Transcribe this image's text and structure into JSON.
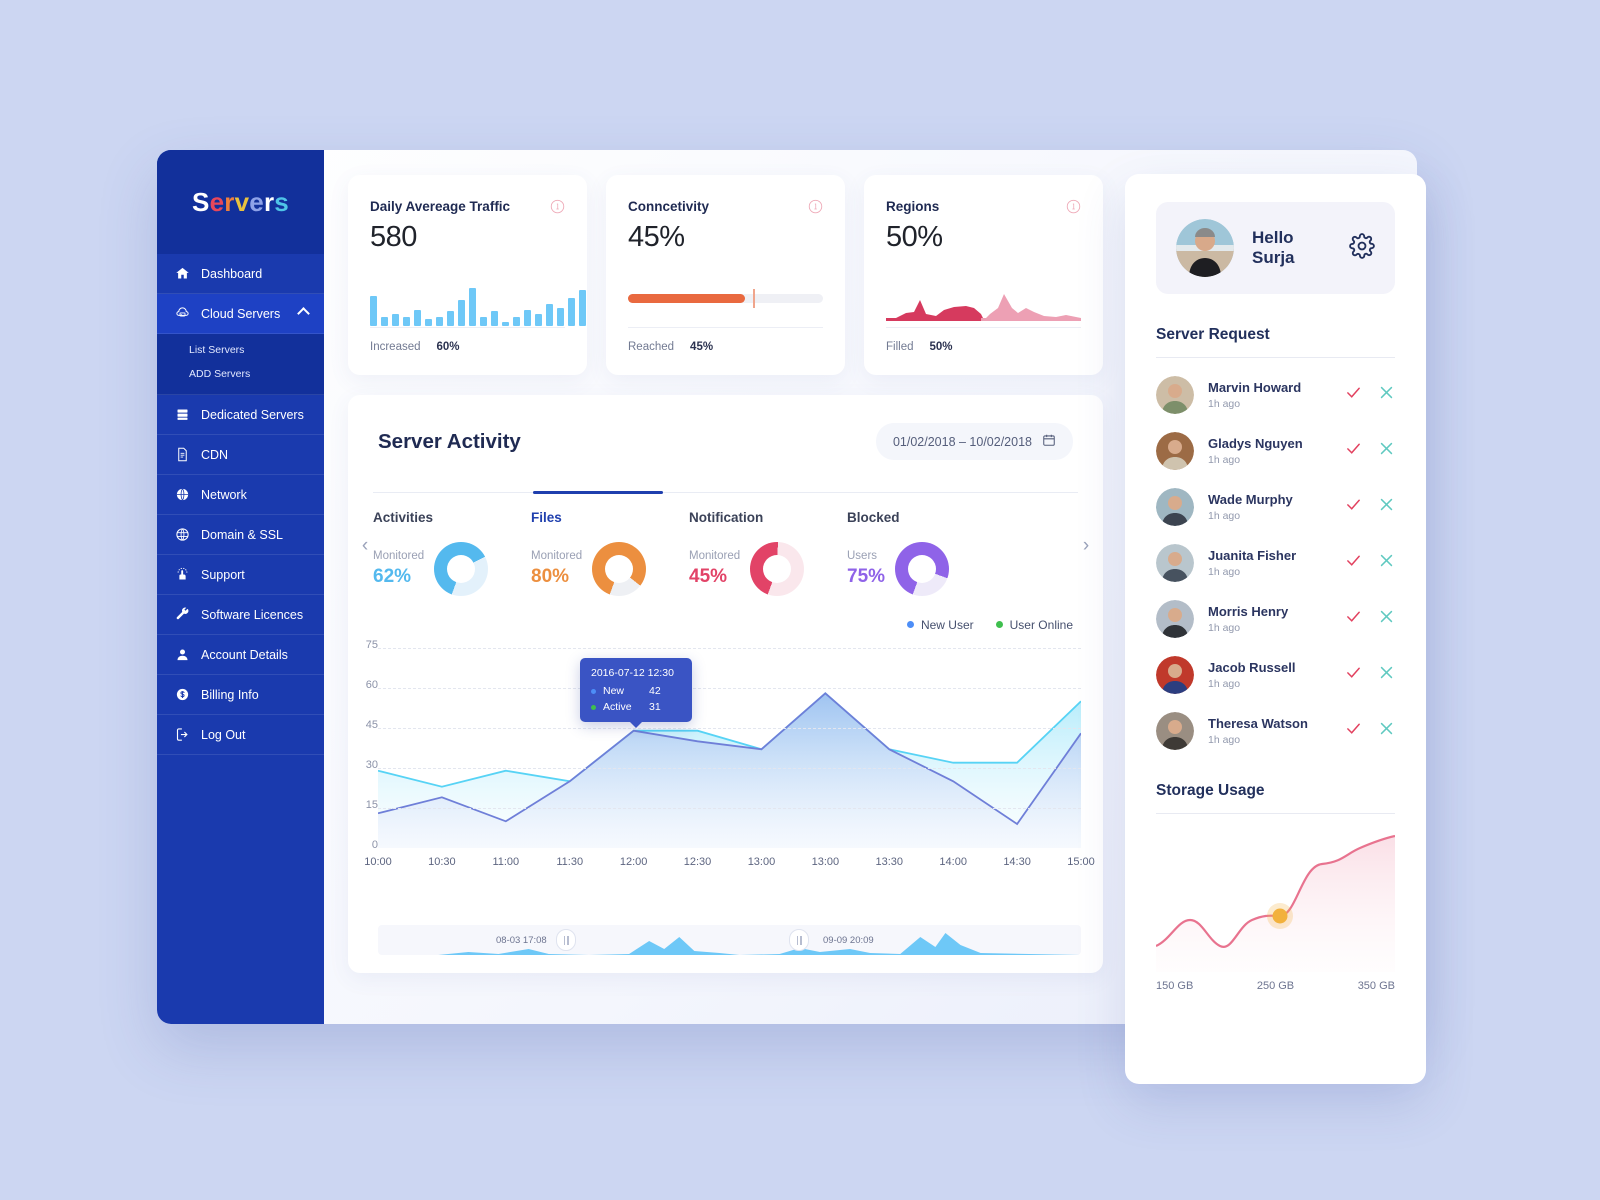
{
  "sidebar": {
    "logo": [
      {
        "ch": "S",
        "color": "#ffffff"
      },
      {
        "ch": "e",
        "color": "#e8475a"
      },
      {
        "ch": "r",
        "color": "#ef7f3c"
      },
      {
        "ch": "v",
        "color": "#e9c23f"
      },
      {
        "ch": "e",
        "color": "#8ea2e8"
      },
      {
        "ch": "r",
        "color": "#ffffff"
      },
      {
        "ch": "s",
        "color": "#4fc4e8"
      }
    ],
    "items": [
      {
        "label": "Dashboard",
        "icon": "home-icon",
        "active": false
      },
      {
        "label": "Cloud Servers",
        "icon": "cloud-server-icon",
        "active": true,
        "expanded": true
      },
      {
        "label": "Dedicated Servers",
        "icon": "server-rack-icon",
        "active": false
      },
      {
        "label": "CDN",
        "icon": "document-icon",
        "active": false
      },
      {
        "label": "Network",
        "icon": "globe-icon",
        "active": false
      },
      {
        "label": "Domain & SSL",
        "icon": "domain-icon",
        "active": false
      },
      {
        "label": "Support",
        "icon": "support-hand-icon",
        "active": false
      },
      {
        "label": "Software Licences",
        "icon": "wrench-icon",
        "active": false
      },
      {
        "label": "Account Details",
        "icon": "user-icon",
        "active": false
      },
      {
        "label": "Billing Info",
        "icon": "dollar-icon",
        "active": false
      },
      {
        "label": "Log Out",
        "icon": "logout-icon",
        "active": false
      }
    ],
    "subitems": [
      "List Servers",
      "ADD Servers"
    ]
  },
  "stats": [
    {
      "title": "Daily Avereage Traffic",
      "value": "580",
      "foot_label": "Increased",
      "foot_value": "60%",
      "viz": "bars",
      "color": "#6ec8f7"
    },
    {
      "title": "Conncetivity",
      "value": "45%",
      "foot_label": "Reached",
      "foot_value": "45%",
      "viz": "progress",
      "color": "#e9693f",
      "progress_pct": 60
    },
    {
      "title": "Regions",
      "value": "50%",
      "foot_label": "Filled",
      "foot_value": "50%",
      "viz": "area",
      "color": "#d0days"
    }
  ],
  "activity": {
    "title": "Server Activity",
    "date_range": "01/02/2018 – 10/02/2018",
    "calendar_icon": "calendar-icon",
    "prev_icon": "chevron-left-icon",
    "next_icon": "chevron-right-icon",
    "tabs": [
      {
        "label": "Activities",
        "metric_label": "Monitored",
        "value": "62%",
        "pct": 62,
        "color": "#54b9ee",
        "track": "#e3f1fb",
        "active": false
      },
      {
        "label": "Files",
        "metric_label": "Monitored",
        "value": "80%",
        "pct": 80,
        "color": "#ec8f3f",
        "track": "#eef0f4",
        "active": true
      },
      {
        "label": "Notification",
        "metric_label": "Monitored",
        "value": "45%",
        "pct": 45,
        "color": "#e24367",
        "track": "#fae7ec",
        "active": false
      },
      {
        "label": "Blocked",
        "metric_label": "Users",
        "value": "75%",
        "pct": 75,
        "color": "#8f63e8",
        "track": "#eeeaf9",
        "active": false
      }
    ]
  },
  "chart_data": {
    "type": "area",
    "title": "Server Activity",
    "xlabel": "",
    "ylabel": "",
    "ylim": [
      0,
      75
    ],
    "yticks": [
      0,
      15,
      30,
      45,
      60,
      75
    ],
    "grid": true,
    "legend_position": "top-right",
    "x": [
      "10:00",
      "10:30",
      "11:00",
      "11:30",
      "12:00",
      "12:30",
      "13:00",
      "13:00",
      "13:30",
      "14:00",
      "14:30",
      "15:00"
    ],
    "series": [
      {
        "name": "New User",
        "color": "#6f7fd8",
        "values": [
          13,
          19,
          10,
          25,
          44,
          40,
          37,
          58,
          37,
          25,
          9,
          43
        ]
      },
      {
        "name": "User Online",
        "color": "#57d3f5",
        "values": [
          29,
          23,
          29,
          25,
          44,
          44,
          37,
          58,
          37,
          32,
          32,
          55
        ]
      }
    ],
    "tooltip": {
      "timestamp": "2016-07-12 12:30",
      "rows": [
        {
          "label": "New",
          "value": "42",
          "color": "#4d8ef7"
        },
        {
          "label": "Active",
          "value": "31",
          "color": "#3fbf4e"
        }
      ]
    },
    "brush": {
      "left_label": "08-03 17:08",
      "right_label": "09-09 20:09"
    }
  },
  "right_panel": {
    "greeting": "Hello Surja",
    "settings_icon": "gear-icon",
    "avatar_name": "avatar",
    "server_request_title": "Server Request",
    "requests": [
      {
        "name": "Marvin Howard",
        "time": "1h ago",
        "av1": "#cdbda6",
        "av2": "#7d8f6a"
      },
      {
        "name": "Gladys Nguyen",
        "time": "1h ago",
        "av1": "#9c6b45",
        "av2": "#cfc3ae"
      },
      {
        "name": "Wade Murphy",
        "time": "1h ago",
        "av1": "#9fb7c2",
        "av2": "#3c4450"
      },
      {
        "name": "Juanita Fisher",
        "time": "1h ago",
        "av1": "#b9c6cd",
        "av2": "#47525f"
      },
      {
        "name": "Morris Henry",
        "time": "1h ago",
        "av1": "#b3bdc8",
        "av2": "#2f3338"
      },
      {
        "name": "Jacob Russell",
        "time": "1h ago",
        "av1": "#c0392b",
        "av2": "#2c3e80"
      },
      {
        "name": "Theresa Watson",
        "time": "1h ago",
        "av1": "#9a8e82",
        "av2": "#3e3a36"
      }
    ],
    "accept_icon": "check-icon",
    "reject_icon": "close-icon",
    "accept_color": "#e2415f",
    "reject_color": "#5fc9c0",
    "storage_title": "Storage Usage",
    "storage_axis": [
      "150 GB",
      "250 GB",
      "350 GB"
    ],
    "storage_line_color": "#e8738f",
    "storage_marker_color": "#f2b13c"
  }
}
